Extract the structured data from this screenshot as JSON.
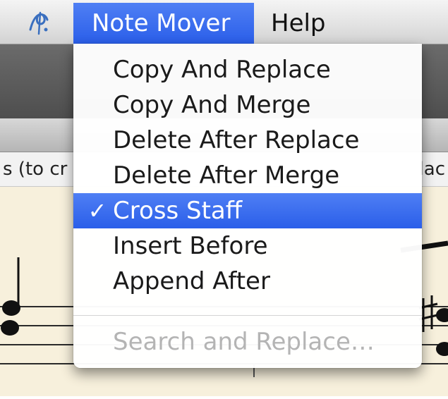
{
  "menubar": {
    "app_icon": "music-clef-icon",
    "items": [
      {
        "label": "Note Mover",
        "active": true
      },
      {
        "label": "Help",
        "active": false
      }
    ]
  },
  "background": {
    "hint_left": "s (to cr",
    "hint_right": "lac"
  },
  "dropdown": {
    "items": [
      {
        "label": "Copy And Replace",
        "checked": false,
        "enabled": true
      },
      {
        "label": "Copy And Merge",
        "checked": false,
        "enabled": true
      },
      {
        "label": "Delete After Replace",
        "checked": false,
        "enabled": true
      },
      {
        "label": "Delete After Merge",
        "checked": false,
        "enabled": true
      },
      {
        "label": "Cross Staff",
        "checked": true,
        "enabled": true,
        "highlighted": true
      },
      {
        "label": "Insert Before",
        "checked": false,
        "enabled": true
      },
      {
        "label": "Append After",
        "checked": false,
        "enabled": true
      }
    ],
    "disabled_item": {
      "label": "Search and Replace…",
      "enabled": false
    },
    "check_glyph": "✓"
  },
  "colors": {
    "highlight": "#2f62eb",
    "menu_text": "#1a1a1a",
    "disabled_text": "#b4b4b4",
    "score_paper": "#f7f0dc"
  }
}
